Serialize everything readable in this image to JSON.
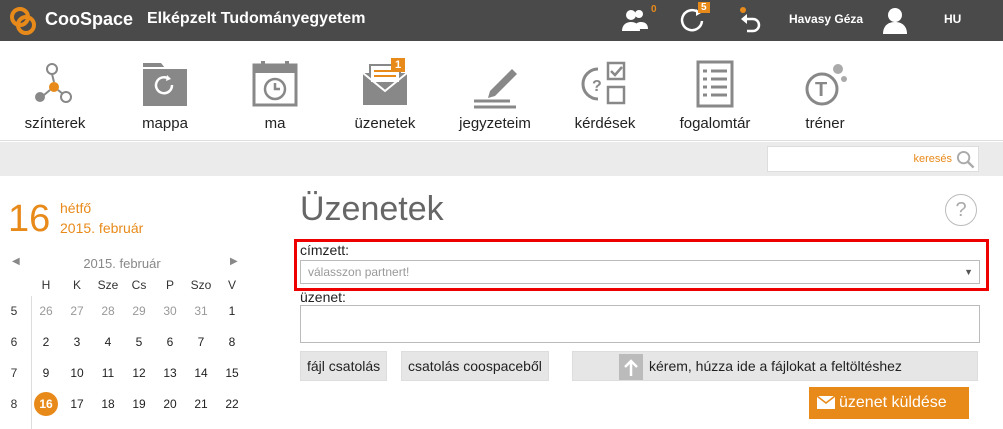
{
  "topbar": {
    "brand": "CooSpace",
    "institution": "Elképzelt Tudományegyetem",
    "contacts_badge": "0",
    "refresh_badge": "5",
    "user_name": "Havasy Géza",
    "language": "HU"
  },
  "tools": [
    {
      "label": "színterek",
      "icon": "scenes-icon"
    },
    {
      "label": "mappa",
      "icon": "folder-icon"
    },
    {
      "label": "ma",
      "icon": "calendar-today-icon"
    },
    {
      "label": "üzenetek",
      "icon": "messages-icon",
      "badge": "1"
    },
    {
      "label": "jegyzeteim",
      "icon": "notes-icon"
    },
    {
      "label": "kérdések",
      "icon": "questions-icon"
    },
    {
      "label": "fogalomtár",
      "icon": "glossary-icon"
    },
    {
      "label": "tréner",
      "icon": "trainer-icon"
    }
  ],
  "search": {
    "placeholder": "keresés"
  },
  "calendar": {
    "day_number": "16",
    "day_name": "hétfő",
    "full_date": "2015. február",
    "month_label": "2015. február",
    "weekday_headers": [
      "H",
      "K",
      "Sze",
      "Cs",
      "P",
      "Szo",
      "V"
    ],
    "weeks": [
      {
        "week": "5",
        "days": [
          "26",
          "27",
          "28",
          "29",
          "30",
          "31",
          "1"
        ]
      },
      {
        "week": "6",
        "days": [
          "2",
          "3",
          "4",
          "5",
          "6",
          "7",
          "8"
        ]
      },
      {
        "week": "7",
        "days": [
          "9",
          "10",
          "11",
          "12",
          "13",
          "14",
          "15"
        ]
      },
      {
        "week": "8",
        "days": [
          "16",
          "17",
          "18",
          "19",
          "20",
          "21",
          "22"
        ]
      }
    ]
  },
  "page": {
    "title": "Üzenetek",
    "help": "?",
    "recipient_label": "címzett:",
    "recipient_placeholder": "válasszon partnert!",
    "message_label": "üzenet:",
    "attach_file": "fájl csatolás",
    "attach_coospace": "csatolás coospaceből",
    "dropzone_text": "kérem, húzza ide a fájlokat a feltöltéshez",
    "send_label": "üzenet küldése"
  },
  "colors": {
    "accent": "#e88a1a",
    "topbar": "#4a4a4a",
    "highlight": "#e00000"
  }
}
